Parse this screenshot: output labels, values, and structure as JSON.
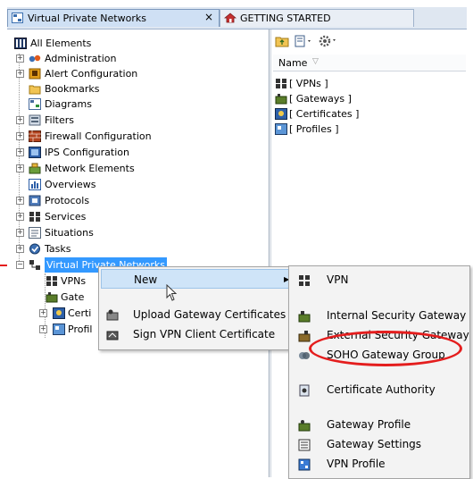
{
  "tabs": [
    {
      "label": "Virtual Private Networks",
      "close": "×"
    },
    {
      "label": "GETTING STARTED"
    }
  ],
  "tree": [
    {
      "label": "All Elements"
    },
    {
      "label": "Administration"
    },
    {
      "label": "Alert Configuration"
    },
    {
      "label": "Bookmarks"
    },
    {
      "label": "Diagrams"
    },
    {
      "label": "Filters"
    },
    {
      "label": "Firewall Configuration"
    },
    {
      "label": "IPS Configuration"
    },
    {
      "label": "Network Elements"
    },
    {
      "label": "Overviews"
    },
    {
      "label": "Protocols"
    },
    {
      "label": "Services"
    },
    {
      "label": "Situations"
    },
    {
      "label": "Tasks"
    },
    {
      "label": "Virtual Private Networks"
    }
  ],
  "subtree": [
    {
      "label": "VPNs"
    },
    {
      "label": "Gate"
    },
    {
      "label": "Certi"
    },
    {
      "label": "Profil"
    }
  ],
  "right_panel": {
    "column_header": "Name",
    "items": [
      "[ VPNs ]",
      "[ Gateways ]",
      "[ Certificates ]",
      "[ Profiles ]"
    ]
  },
  "context_menu": {
    "new": "New",
    "items": [
      "Upload Gateway Certificates",
      "Sign VPN Client Certificate"
    ]
  },
  "submenu": {
    "items": [
      "VPN",
      "Internal Security Gateway",
      "External Security Gateway",
      "SOHO Gateway Group",
      "Certificate Authority",
      "Gateway Profile",
      "Gateway Settings",
      "VPN Profile"
    ]
  },
  "colors": {
    "selection": "#3399ff",
    "highlight_circle": "#e41d1d"
  }
}
